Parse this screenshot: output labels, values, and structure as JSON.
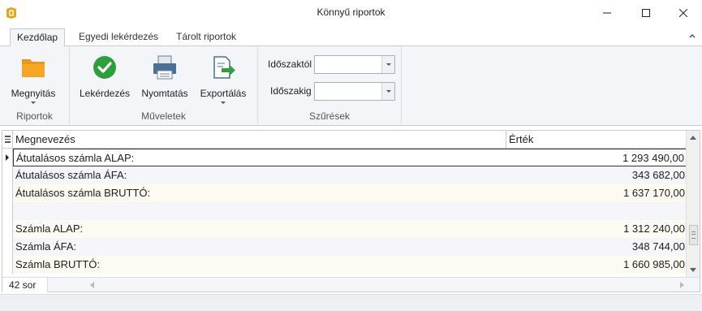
{
  "window": {
    "title": "Könnyű riportok",
    "brand_color": "#e8a317"
  },
  "tabs": [
    {
      "label": "Kezdőlap",
      "active": true
    },
    {
      "label": "Egyedi lekérdezés",
      "active": false
    },
    {
      "label": "Tárolt riportok",
      "active": false
    }
  ],
  "ribbon": {
    "groups": {
      "riportok": {
        "caption": "Riportok",
        "buttons": {
          "open": {
            "label": "Megnyitás",
            "icon": "folder-icon"
          }
        }
      },
      "muveletek": {
        "caption": "Műveletek",
        "buttons": {
          "query": {
            "label": "Lekérdezés",
            "icon": "checkmark-icon"
          },
          "print": {
            "label": "Nyomtatás",
            "icon": "printer-icon"
          },
          "export": {
            "label": "Exportálás",
            "icon": "export-icon"
          }
        }
      },
      "szuresek": {
        "caption": "Szűrések",
        "from_label": "Időszaktól",
        "from_value": "",
        "to_label": "Időszakig",
        "to_value": ""
      }
    }
  },
  "grid": {
    "columns": {
      "name": "Megnevezés",
      "value": "Érték"
    },
    "rows": [
      {
        "name": "Átutalásos számla ALAP:",
        "value": "1 293 490,00"
      },
      {
        "name": "Átutalásos számla ÁFA:",
        "value": "343 682,00"
      },
      {
        "name": "Átutalásos számla BRUTTÓ:",
        "value": "1 637 170,00"
      },
      {
        "name": "",
        "value": ""
      },
      {
        "name": "Számla ALAP:",
        "value": "1 312 240,00"
      },
      {
        "name": "Számla ÁFA:",
        "value": "348 744,00"
      },
      {
        "name": "Számla BRUTTÓ:",
        "value": "1 660 985,00"
      }
    ],
    "row_count": "42 sor"
  },
  "colors": {
    "accent_green": "#2e9e3e",
    "folder_orange": "#f5a623",
    "printer_blue": "#4a6f99"
  }
}
